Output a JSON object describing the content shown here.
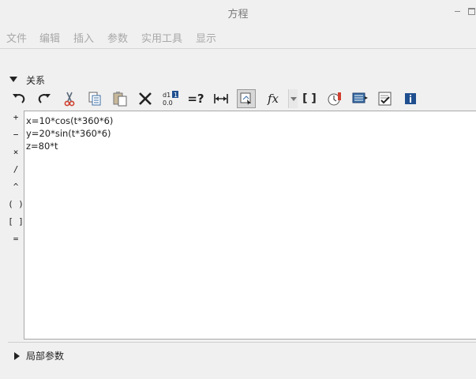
{
  "window": {
    "title": "方程"
  },
  "menu": [
    "文件",
    "编辑",
    "插入",
    "参数",
    "实用工具",
    "显示"
  ],
  "relations_section": {
    "label": "关系"
  },
  "toolbar": {
    "icons": [
      "undo-icon",
      "redo-icon",
      "cut-icon",
      "copy-icon",
      "paste-icon",
      "delete-icon",
      "sort-relations-icon",
      "evaluate-icon",
      "measure-distance-icon",
      "select-from-model-icon",
      "insert-function-icon",
      "function-dropdown-icon",
      "brackets-icon",
      "check-relations-icon",
      "display-value-icon",
      "verify-icon",
      "info-icon"
    ],
    "evaluate_label": "=?",
    "brackets_label": "[ ]",
    "function_label": "fx"
  },
  "operators": [
    "+",
    "−",
    "×",
    "/",
    "^",
    "( )",
    "[ ]",
    "="
  ],
  "equations": [
    "x=10*cos(t*360*6)",
    "y=20*sin(t*360*6)",
    "z=80*t"
  ],
  "local_params_section": {
    "label": "局部参数"
  }
}
